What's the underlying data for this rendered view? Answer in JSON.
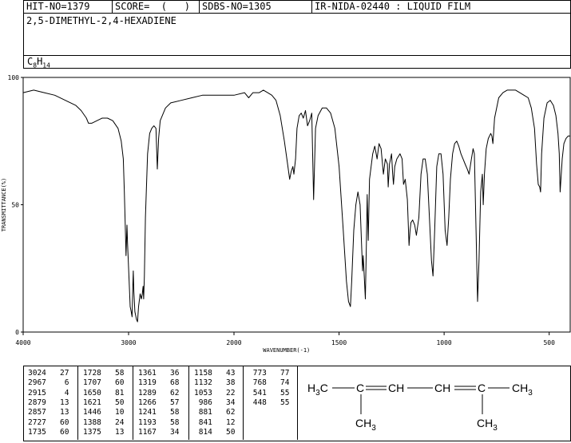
{
  "header": {
    "hit_no": "HIT-NO=1379",
    "score": "SCORE=  (   )",
    "sdbs_no": "SDBS-NO=1305",
    "source": "IR-NIDA-02440 : LIQUID FILM"
  },
  "compound": {
    "name": "2,5-DIMETHYL-2,4-HEXADIENE",
    "formula_main": "C",
    "formula_c_count": "8",
    "formula_h": "H",
    "formula_h_count": "14"
  },
  "chart_data": {
    "type": "line",
    "xlabel": "WAVENUMBER(-1)",
    "ylabel": "TRANSMITTANCE(%)",
    "xlim": [
      4000,
      400
    ],
    "ylim": [
      0,
      100
    ],
    "x_ticks": [
      "4000",
      "3000",
      "2000",
      "1500",
      "1000",
      "500"
    ],
    "y_ticks": [
      "100",
      "50",
      "0"
    ],
    "series": [
      {
        "points": [
          [
            4000,
            94
          ],
          [
            3900,
            95
          ],
          [
            3800,
            94
          ],
          [
            3700,
            93
          ],
          [
            3600,
            91
          ],
          [
            3500,
            89
          ],
          [
            3450,
            87
          ],
          [
            3400,
            84
          ],
          [
            3380,
            82
          ],
          [
            3350,
            82
          ],
          [
            3300,
            83
          ],
          [
            3250,
            84
          ],
          [
            3200,
            84
          ],
          [
            3150,
            83
          ],
          [
            3100,
            80
          ],
          [
            3070,
            75
          ],
          [
            3050,
            68
          ],
          [
            3040,
            55
          ],
          [
            3030,
            40
          ],
          [
            3024,
            30
          ],
          [
            3020,
            36
          ],
          [
            3015,
            42
          ],
          [
            3010,
            35
          ],
          [
            2995,
            20
          ],
          [
            2985,
            10
          ],
          [
            2975,
            8
          ],
          [
            2967,
            6
          ],
          [
            2960,
            18
          ],
          [
            2955,
            24
          ],
          [
            2950,
            16
          ],
          [
            2940,
            8
          ],
          [
            2925,
            5
          ],
          [
            2915,
            4
          ],
          [
            2905,
            10
          ],
          [
            2890,
            15
          ],
          [
            2879,
            13
          ],
          [
            2870,
            15
          ],
          [
            2862,
            18
          ],
          [
            2857,
            13
          ],
          [
            2850,
            22
          ],
          [
            2840,
            45
          ],
          [
            2820,
            70
          ],
          [
            2800,
            78
          ],
          [
            2780,
            80
          ],
          [
            2760,
            81
          ],
          [
            2740,
            80
          ],
          [
            2727,
            64
          ],
          [
            2715,
            76
          ],
          [
            2700,
            83
          ],
          [
            2650,
            88
          ],
          [
            2600,
            90
          ],
          [
            2500,
            91
          ],
          [
            2400,
            92
          ],
          [
            2300,
            93
          ],
          [
            2200,
            93
          ],
          [
            2100,
            93
          ],
          [
            2000,
            93
          ],
          [
            1950,
            94
          ],
          [
            1930,
            92
          ],
          [
            1910,
            94
          ],
          [
            1880,
            94
          ],
          [
            1860,
            95
          ],
          [
            1840,
            94
          ],
          [
            1820,
            93
          ],
          [
            1800,
            91
          ],
          [
            1780,
            85
          ],
          [
            1760,
            75
          ],
          [
            1745,
            66
          ],
          [
            1735,
            60
          ],
          [
            1728,
            63
          ],
          [
            1720,
            65
          ],
          [
            1715,
            62
          ],
          [
            1707,
            68
          ],
          [
            1700,
            80
          ],
          [
            1690,
            85
          ],
          [
            1680,
            86
          ],
          [
            1670,
            84
          ],
          [
            1660,
            87
          ],
          [
            1650,
            81
          ],
          [
            1640,
            83
          ],
          [
            1630,
            86
          ],
          [
            1621,
            52
          ],
          [
            1612,
            80
          ],
          [
            1600,
            85
          ],
          [
            1580,
            88
          ],
          [
            1560,
            88
          ],
          [
            1540,
            86
          ],
          [
            1520,
            80
          ],
          [
            1500,
            65
          ],
          [
            1480,
            40
          ],
          [
            1465,
            20
          ],
          [
            1455,
            12
          ],
          [
            1446,
            10
          ],
          [
            1440,
            20
          ],
          [
            1430,
            40
          ],
          [
            1420,
            50
          ],
          [
            1410,
            55
          ],
          [
            1400,
            50
          ],
          [
            1388,
            24
          ],
          [
            1385,
            30
          ],
          [
            1380,
            22
          ],
          [
            1375,
            13
          ],
          [
            1370,
            35
          ],
          [
            1366,
            54
          ],
          [
            1361,
            36
          ],
          [
            1355,
            60
          ],
          [
            1340,
            70
          ],
          [
            1330,
            73
          ],
          [
            1319,
            68
          ],
          [
            1310,
            74
          ],
          [
            1300,
            72
          ],
          [
            1289,
            62
          ],
          [
            1280,
            68
          ],
          [
            1270,
            66
          ],
          [
            1266,
            57
          ],
          [
            1260,
            66
          ],
          [
            1250,
            70
          ],
          [
            1245,
            62
          ],
          [
            1241,
            58
          ],
          [
            1235,
            65
          ],
          [
            1225,
            68
          ],
          [
            1210,
            70
          ],
          [
            1200,
            68
          ],
          [
            1193,
            58
          ],
          [
            1185,
            60
          ],
          [
            1175,
            52
          ],
          [
            1167,
            34
          ],
          [
            1162,
            40
          ],
          [
            1158,
            43
          ],
          [
            1150,
            44
          ],
          [
            1140,
            42
          ],
          [
            1132,
            38
          ],
          [
            1120,
            45
          ],
          [
            1110,
            62
          ],
          [
            1100,
            68
          ],
          [
            1090,
            68
          ],
          [
            1080,
            62
          ],
          [
            1070,
            45
          ],
          [
            1060,
            28
          ],
          [
            1053,
            22
          ],
          [
            1045,
            40
          ],
          [
            1035,
            65
          ],
          [
            1025,
            70
          ],
          [
            1015,
            70
          ],
          [
            1005,
            62
          ],
          [
            995,
            40
          ],
          [
            986,
            34
          ],
          [
            978,
            45
          ],
          [
            970,
            60
          ],
          [
            960,
            70
          ],
          [
            950,
            74
          ],
          [
            940,
            75
          ],
          [
            930,
            73
          ],
          [
            920,
            70
          ],
          [
            910,
            68
          ],
          [
            900,
            66
          ],
          [
            890,
            64
          ],
          [
            881,
            62
          ],
          [
            870,
            68
          ],
          [
            862,
            72
          ],
          [
            856,
            70
          ],
          [
            848,
            40
          ],
          [
            841,
            12
          ],
          [
            834,
            28
          ],
          [
            826,
            55
          ],
          [
            818,
            62
          ],
          [
            814,
            50
          ],
          [
            808,
            62
          ],
          [
            800,
            72
          ],
          [
            790,
            76
          ],
          [
            778,
            78
          ],
          [
            773,
            77
          ],
          [
            768,
            74
          ],
          [
            760,
            84
          ],
          [
            740,
            92
          ],
          [
            720,
            94
          ],
          [
            700,
            95
          ],
          [
            680,
            95
          ],
          [
            660,
            95
          ],
          [
            640,
            94
          ],
          [
            620,
            93
          ],
          [
            600,
            92
          ],
          [
            585,
            88
          ],
          [
            570,
            80
          ],
          [
            560,
            66
          ],
          [
            552,
            58
          ],
          [
            545,
            57
          ],
          [
            541,
            55
          ],
          [
            536,
            70
          ],
          [
            525,
            84
          ],
          [
            510,
            90
          ],
          [
            495,
            91
          ],
          [
            480,
            89
          ],
          [
            468,
            85
          ],
          [
            458,
            78
          ],
          [
            452,
            70
          ],
          [
            448,
            55
          ],
          [
            444,
            60
          ],
          [
            438,
            68
          ],
          [
            430,
            74
          ],
          [
            420,
            76
          ],
          [
            410,
            77
          ],
          [
            400,
            77
          ]
        ]
      }
    ]
  },
  "peak_table": {
    "columns": [
      [
        [
          "3024",
          "27"
        ],
        [
          "2967",
          "6"
        ],
        [
          "2915",
          "4"
        ],
        [
          "2879",
          "13"
        ],
        [
          "2857",
          "13"
        ],
        [
          "2727",
          "60"
        ],
        [
          "1735",
          "60"
        ]
      ],
      [
        [
          "1728",
          "58"
        ],
        [
          "1707",
          "60"
        ],
        [
          "1650",
          "81"
        ],
        [
          "1621",
          "50"
        ],
        [
          "1446",
          "10"
        ],
        [
          "1388",
          "24"
        ],
        [
          "1375",
          "13"
        ]
      ],
      [
        [
          "1361",
          "36"
        ],
        [
          "1319",
          "68"
        ],
        [
          "1289",
          "62"
        ],
        [
          "1266",
          "57"
        ],
        [
          "1241",
          "58"
        ],
        [
          "1193",
          "58"
        ],
        [
          "1167",
          "34"
        ]
      ],
      [
        [
          "1158",
          "43"
        ],
        [
          "1132",
          "38"
        ],
        [
          "1053",
          "22"
        ],
        [
          "986",
          "34"
        ],
        [
          "881",
          "62"
        ],
        [
          "841",
          "12"
        ],
        [
          "814",
          "50"
        ]
      ],
      [
        [
          "773",
          "77"
        ],
        [
          "768",
          "74"
        ],
        [
          "541",
          "55"
        ],
        [
          "448",
          "55"
        ]
      ]
    ]
  },
  "structure": {
    "left_group": "H",
    "left_sub": "3",
    "left_c": "C",
    "c2": "C",
    "ch1": "CH",
    "ch2": "CH",
    "c5": "C",
    "right_group": "CH",
    "right_sub": "3",
    "methyl_1": "CH",
    "methyl_1_sub": "3",
    "methyl_2": "CH",
    "methyl_2_sub": "3"
  }
}
